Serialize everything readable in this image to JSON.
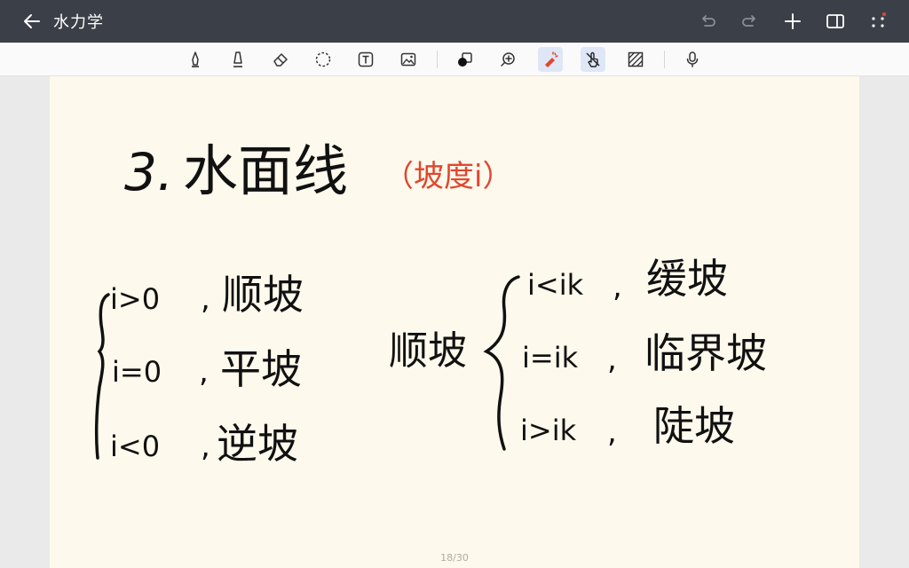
{
  "app": {
    "title": "水力学"
  },
  "note": {
    "heading_number": "3.",
    "heading": "水面线",
    "heading_note": "（坡度i）",
    "left_group": [
      {
        "cond": "i>0",
        "label": "顺坡"
      },
      {
        "cond": "i=0",
        "label": "平坡"
      },
      {
        "cond": "i<0",
        "label": "逆坡"
      }
    ],
    "right_group_title": "顺坡",
    "right_group": [
      {
        "cond": "i<ik",
        "label": "缓坡"
      },
      {
        "cond": "i=ik",
        "label": "临界坡"
      },
      {
        "cond": "i>ik",
        "label": "陡坡"
      }
    ],
    "page_indicator": "18/30"
  },
  "colors": {
    "ink": "#111111",
    "accent_red": "#e0472f",
    "titlebar": "#3b4048",
    "paper": "#fdf9ec"
  }
}
